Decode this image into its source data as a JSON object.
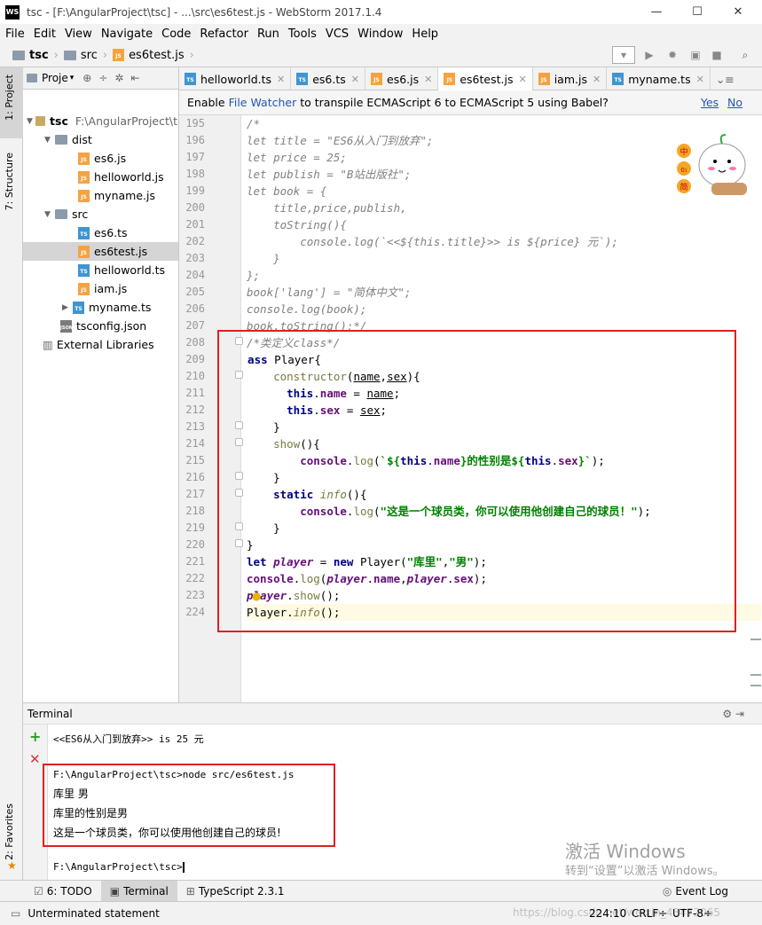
{
  "window": {
    "title": "tsc - [F:\\AngularProject\\tsc] - ...\\src\\es6test.js - WebStorm 2017.1.4",
    "icon_text": "WS",
    "min": "—",
    "max": "☐",
    "close": "✕"
  },
  "menu": [
    "File",
    "Edit",
    "View",
    "Navigate",
    "Code",
    "Refactor",
    "Run",
    "Tools",
    "VCS",
    "Window",
    "Help"
  ],
  "breadcrumb": [
    "tsc",
    "src",
    "es6test.js"
  ],
  "left_tools": [
    "1: Project",
    "7: Structure",
    "2: Favorites"
  ],
  "project": {
    "header": "Proje",
    "root_name": "tsc",
    "root_path": "F:\\AngularProject\\t",
    "dist": "dist",
    "dist_files": [
      "es6.js",
      "helloworld.js",
      "myname.js"
    ],
    "src": "src",
    "src_files": [
      "es6.ts",
      "es6test.js",
      "helloworld.ts",
      "iam.js",
      "myname.ts"
    ],
    "tsconfig": "tsconfig.json",
    "external": "External Libraries"
  },
  "tabs": [
    "helloworld.ts",
    "es6.ts",
    "es6.js",
    "es6test.js",
    "iam.js",
    "myname.ts"
  ],
  "tabs_overflow": "⌄≡",
  "notice": {
    "prefix": "Enable ",
    "link": "File Watcher",
    "suffix": " to transpile ECMAScript 6 to ECMAScript 5 using Babel?",
    "yes": "Yes",
    "no": "No"
  },
  "line_numbers": [
    "195",
    "196",
    "197",
    "198",
    "199",
    "200",
    "201",
    "202",
    "203",
    "204",
    "205",
    "206",
    "207",
    "208",
    "209",
    "210",
    "211",
    "212",
    "213",
    "214",
    "215",
    "216",
    "217",
    "218",
    "219",
    "220",
    "221",
    "222",
    "223",
    "224"
  ],
  "mascot_text": [
    "中",
    "0₁",
    "简"
  ],
  "terminal": {
    "title": "Terminal",
    "line1": "<<ES6从入门到放弃>> is 25 元",
    "cmd": "F:\\AngularProject\\tsc>node src/es6test.js",
    "out1": "库里 男",
    "out2": "库里的性别是男",
    "out3": "这是一个球员类，你可以使用他创建自己的球员!",
    "prompt": "F:\\AngularProject\\tsc>"
  },
  "bottom_tabs": [
    "6: TODO",
    "Terminal",
    "TypeScript 2.3.1"
  ],
  "event_log": "Event Log",
  "status": {
    "message": "Unterminated statement",
    "position": "224:10",
    "line_sep": "CRLF÷",
    "encoding": "UTF-8÷"
  },
  "watermark": {
    "line1": "激活 Windows",
    "line2": "转到“设置”以激活 Windows。",
    "url": "https://blog.csdn.net/weixin_43472065"
  }
}
